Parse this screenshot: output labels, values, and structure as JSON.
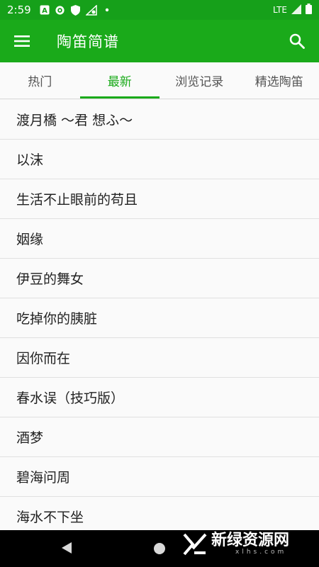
{
  "status_bar": {
    "time": "2:59",
    "network": "LTE",
    "icons": [
      "a-badge-icon",
      "gear-icon",
      "shield-icon",
      "signal-settings-icon",
      "dot-icon",
      "signal-icon",
      "battery-icon"
    ]
  },
  "app_bar": {
    "title": "陶笛简谱",
    "menu_icon": "menu-icon",
    "search_icon": "search-icon",
    "color": "#1aaa1a"
  },
  "tabs": [
    {
      "label": "热门",
      "active": false
    },
    {
      "label": "最新",
      "active": true
    },
    {
      "label": "浏览记录",
      "active": false
    },
    {
      "label": "精选陶笛",
      "active": false
    }
  ],
  "songs": [
    "渡月橋 ～君 想ふ～",
    "以沫",
    "生活不止眼前的苟且",
    "姻缘",
    "伊豆的舞女",
    "吃掉你的胰脏",
    "因你而在",
    "春水误（技巧版）",
    "酒梦",
    "碧海问周",
    "海水不下坐"
  ],
  "watermark": {
    "text": "新绿资源网",
    "sub": "xlhs.com"
  }
}
